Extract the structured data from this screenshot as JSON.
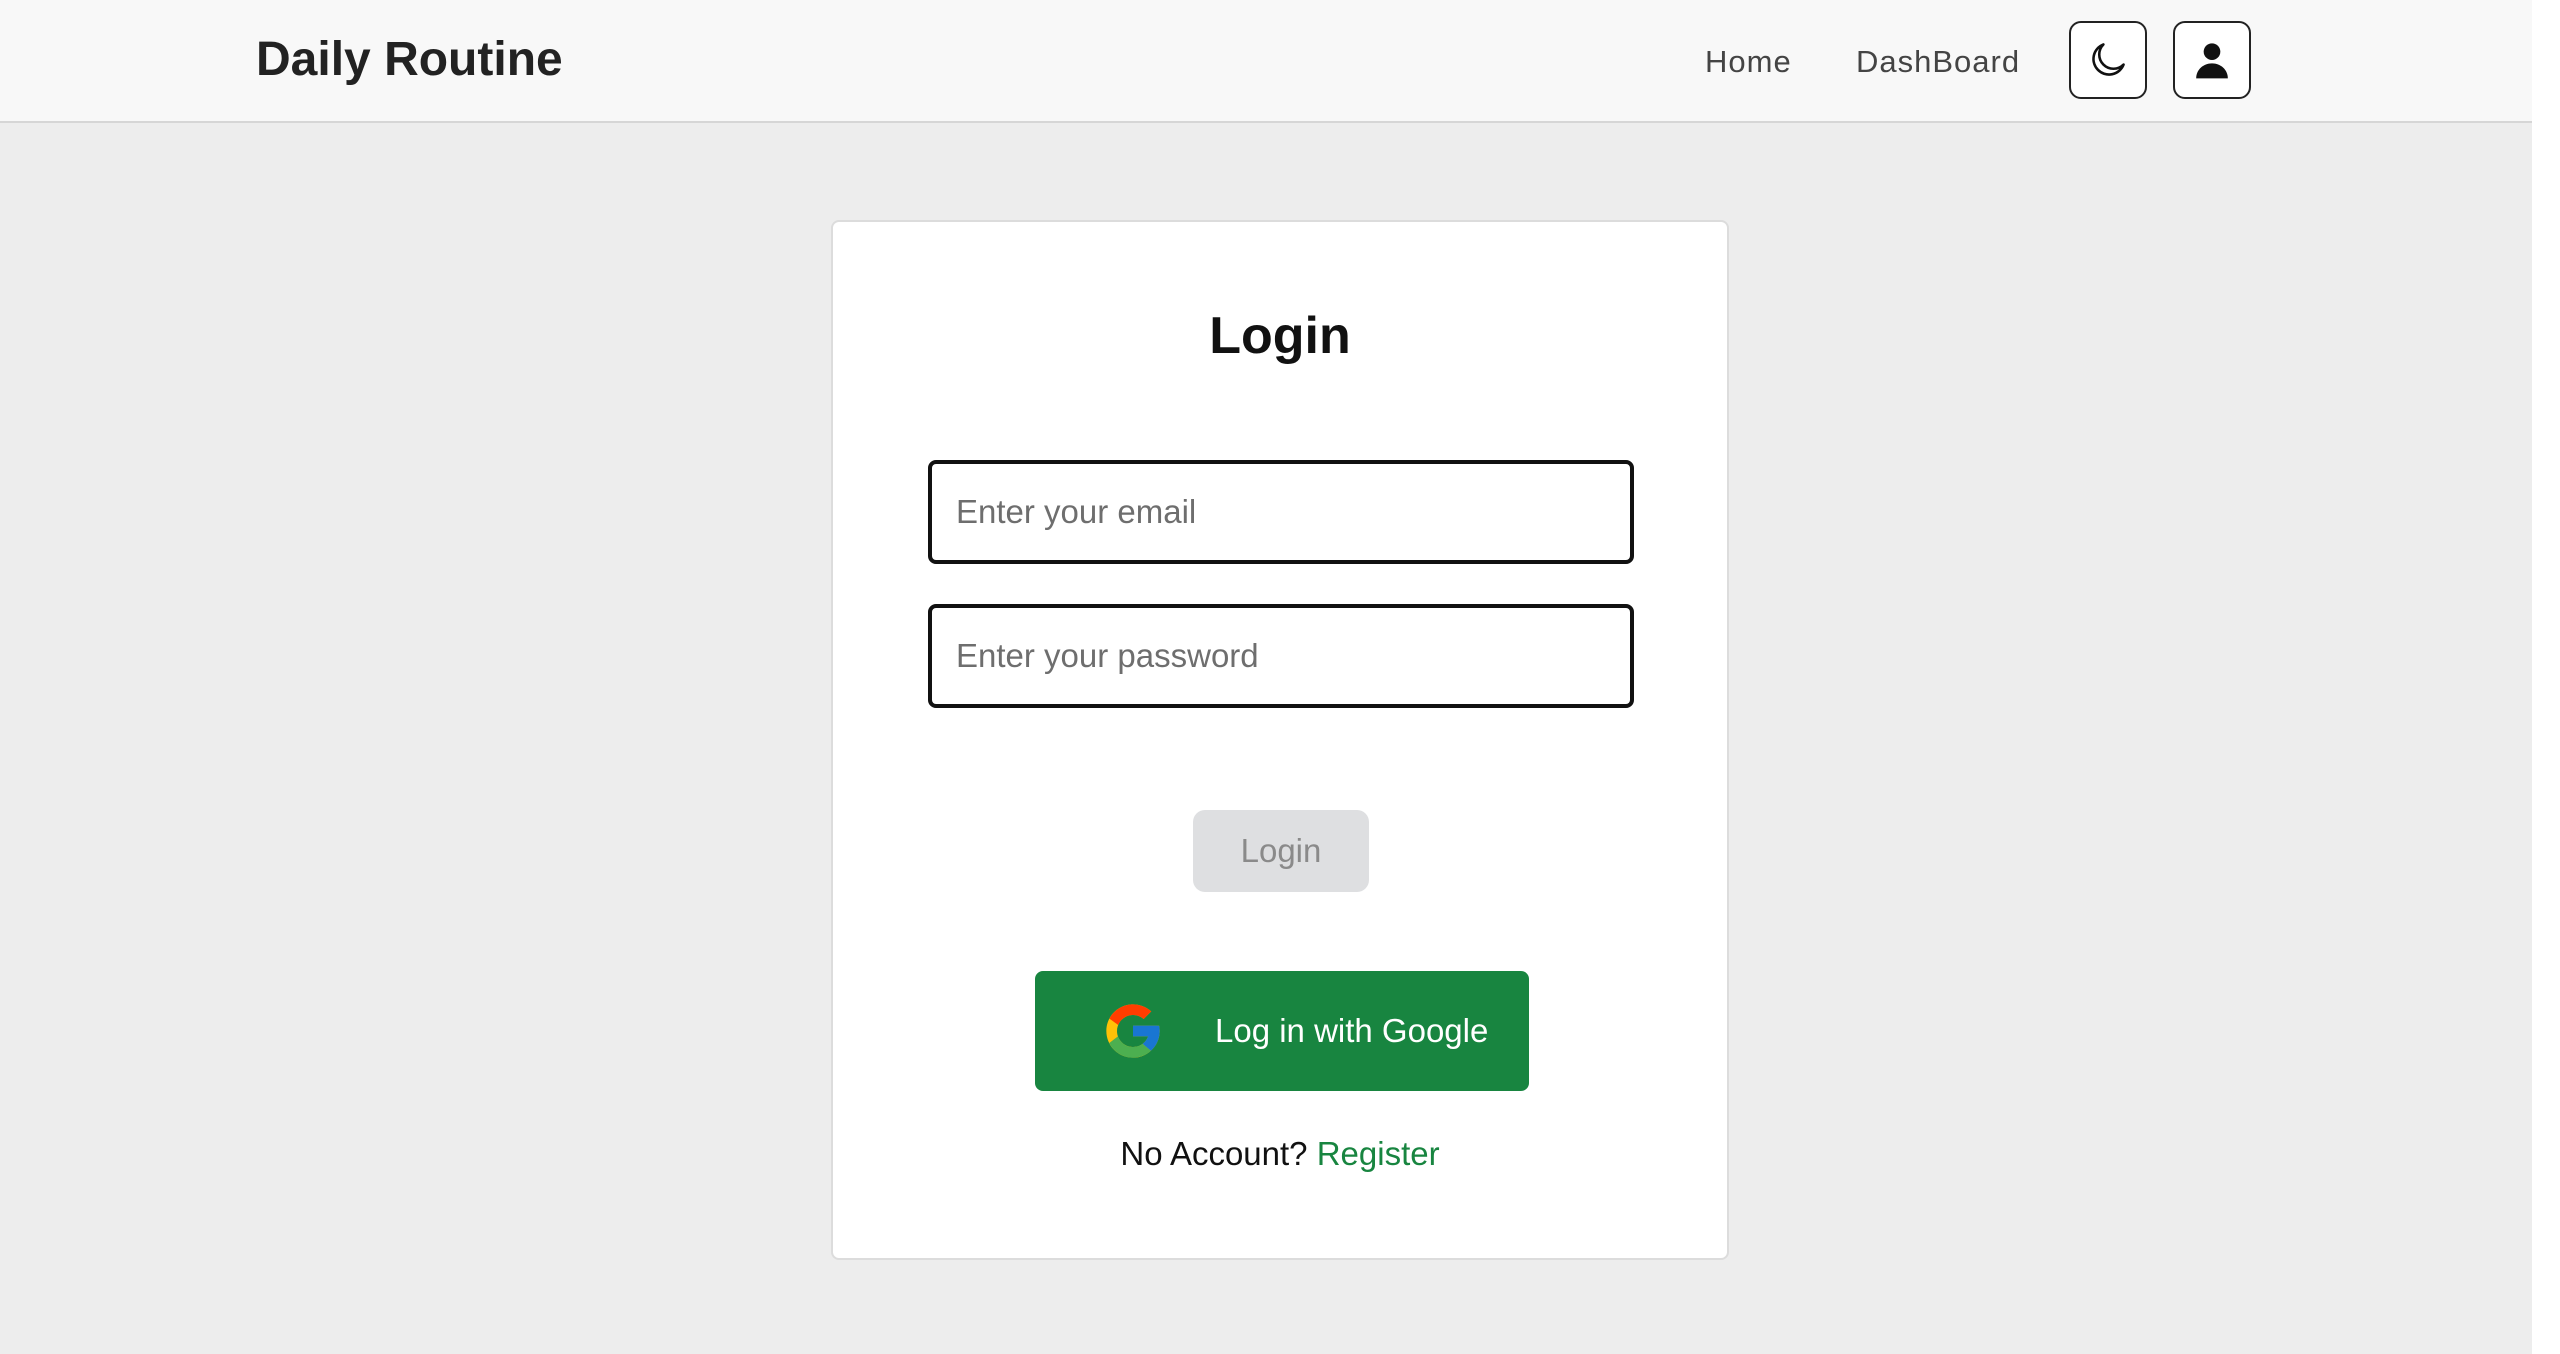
{
  "navbar": {
    "brand": "Daily Routine",
    "links": [
      {
        "label": "Home"
      },
      {
        "label": "DashBoard"
      }
    ],
    "theme_toggle_icon": "moon-icon",
    "profile_icon": "user-icon"
  },
  "login_card": {
    "title": "Login",
    "email_placeholder": "Enter your email",
    "email_value": "",
    "password_placeholder": "Enter your password",
    "password_value": "",
    "login_button_label": "Login",
    "google_button_label": "Log in with Google",
    "google_icon": "google-logo-icon",
    "register_prompt": "No Account?",
    "register_link_label": "Register"
  },
  "colors": {
    "accent_green": "#188540",
    "page_background": "#ededed",
    "navbar_background": "#f8f8f8",
    "disabled_button": "#dedfe1"
  }
}
